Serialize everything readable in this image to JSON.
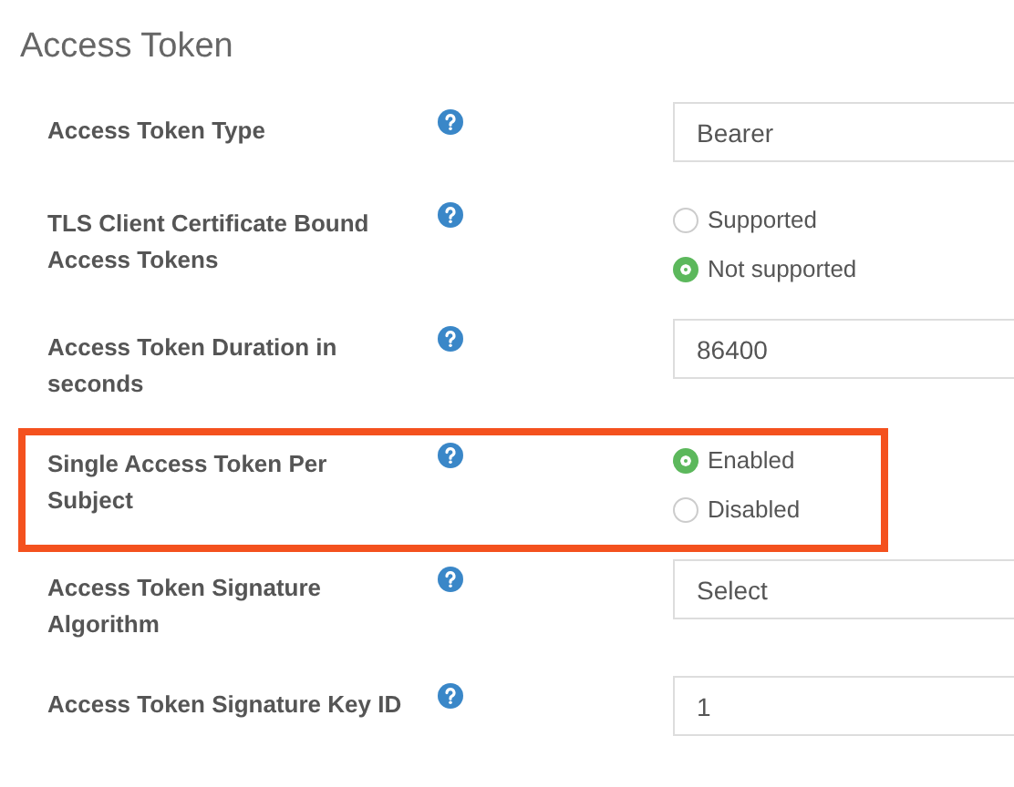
{
  "section": {
    "title": "Access Token"
  },
  "fields": [
    {
      "label": "Access Token Type",
      "kind": "input",
      "value": "Bearer",
      "highlighted": false
    },
    {
      "label": "TLS Client Certificate Bound Access Tokens",
      "kind": "radio",
      "highlighted": false,
      "options": [
        {
          "label": "Supported",
          "selected": false
        },
        {
          "label": "Not supported",
          "selected": true
        }
      ]
    },
    {
      "label": "Access Token Duration in seconds",
      "kind": "input",
      "value": "86400",
      "highlighted": false
    },
    {
      "label": "Single Access Token Per Subject",
      "kind": "radio",
      "highlighted": true,
      "options": [
        {
          "label": "Enabled",
          "selected": true
        },
        {
          "label": "Disabled",
          "selected": false
        }
      ]
    },
    {
      "label": "Access Token Signature Algorithm",
      "kind": "select",
      "value": "Select",
      "highlighted": false
    },
    {
      "label": "Access Token Signature Key ID",
      "kind": "input",
      "value": "1",
      "highlighted": false
    }
  ]
}
